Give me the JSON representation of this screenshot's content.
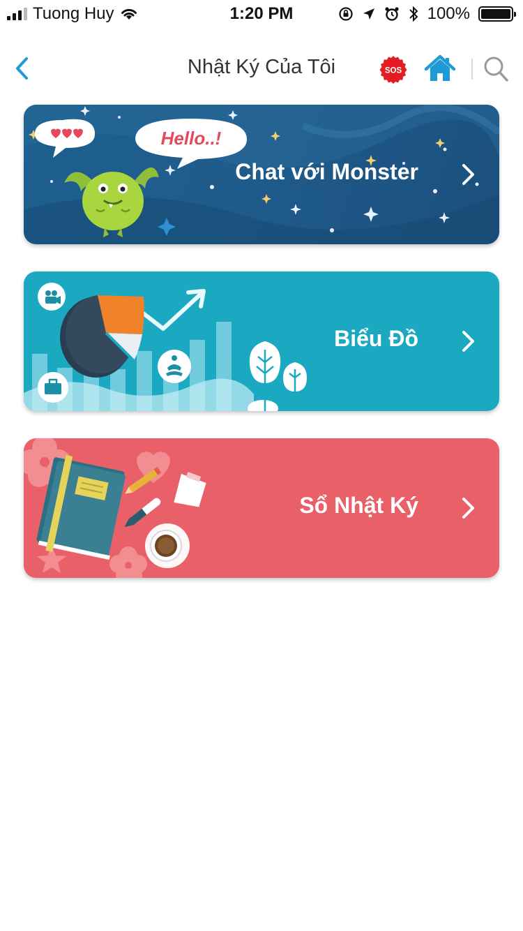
{
  "status_bar": {
    "carrier": "Tuong Huy",
    "time": "1:20 PM",
    "battery": "100%"
  },
  "nav": {
    "title": "Nhật Ký Của Tôi",
    "sos_label": "SOS"
  },
  "cards": [
    {
      "label": "Chat với Monster",
      "bubble_text": "Hello..!"
    },
    {
      "label": "Biểu Đồ"
    },
    {
      "label": "Sổ Nhật Ký"
    }
  ],
  "colors": {
    "accent": "#1e9ad6",
    "monster_card": "#1d5f8f",
    "chart_card": "#1ba9c2",
    "diary_card": "#ea6069",
    "sos_red": "#e31b23"
  },
  "icons": {
    "back": "chevron-left-icon",
    "sos": "sos-badge-icon",
    "home": "home-icon",
    "search": "search-icon",
    "card_arrow": "chevron-right-icon"
  }
}
